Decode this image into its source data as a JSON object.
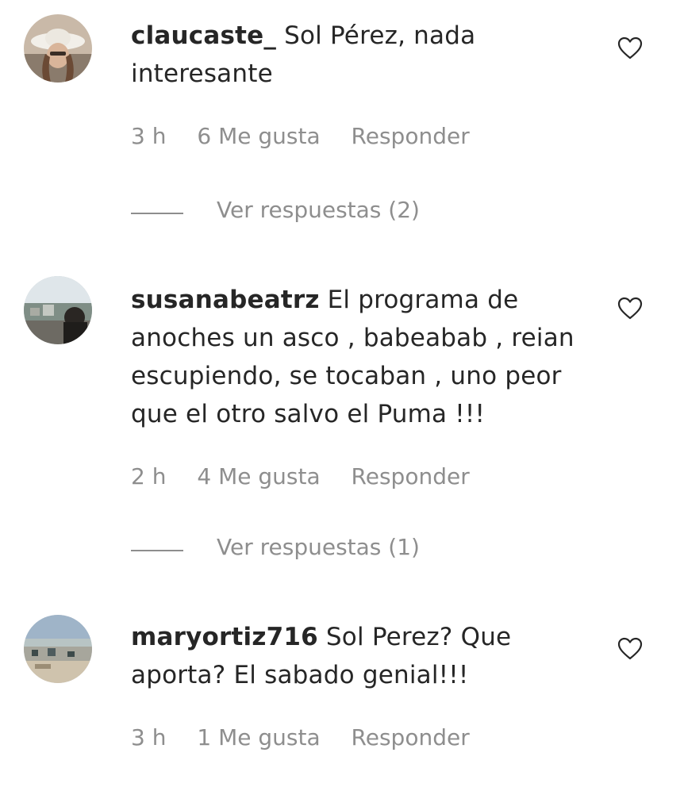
{
  "comments": [
    {
      "username": "claucaste_",
      "text": "Sol Pérez, nada interesante",
      "time": "3 h",
      "likes": "6 Me gusta",
      "reply": "Responder",
      "view_replies": "Ver respuestas (2)",
      "like_icon": "heart-outline-icon"
    },
    {
      "username": "susanabeatrz",
      "text": "El programa de anoches un asco , babeabab , reian escupiendo, se tocaban , uno peor que el otro salvo el Puma !!!",
      "time": "2 h",
      "likes": "4 Me gusta",
      "reply": "Responder",
      "view_replies": "Ver respuestas (1)",
      "like_icon": "heart-outline-icon"
    },
    {
      "username": "maryortiz716",
      "text": "Sol Perez? Que aporta? El sabado genial!!!",
      "time": "3 h",
      "likes": "1 Me gusta",
      "reply": "Responder",
      "like_icon": "heart-outline-icon"
    }
  ],
  "colors": {
    "text": "#262626",
    "secondary": "#8e8e8e"
  }
}
